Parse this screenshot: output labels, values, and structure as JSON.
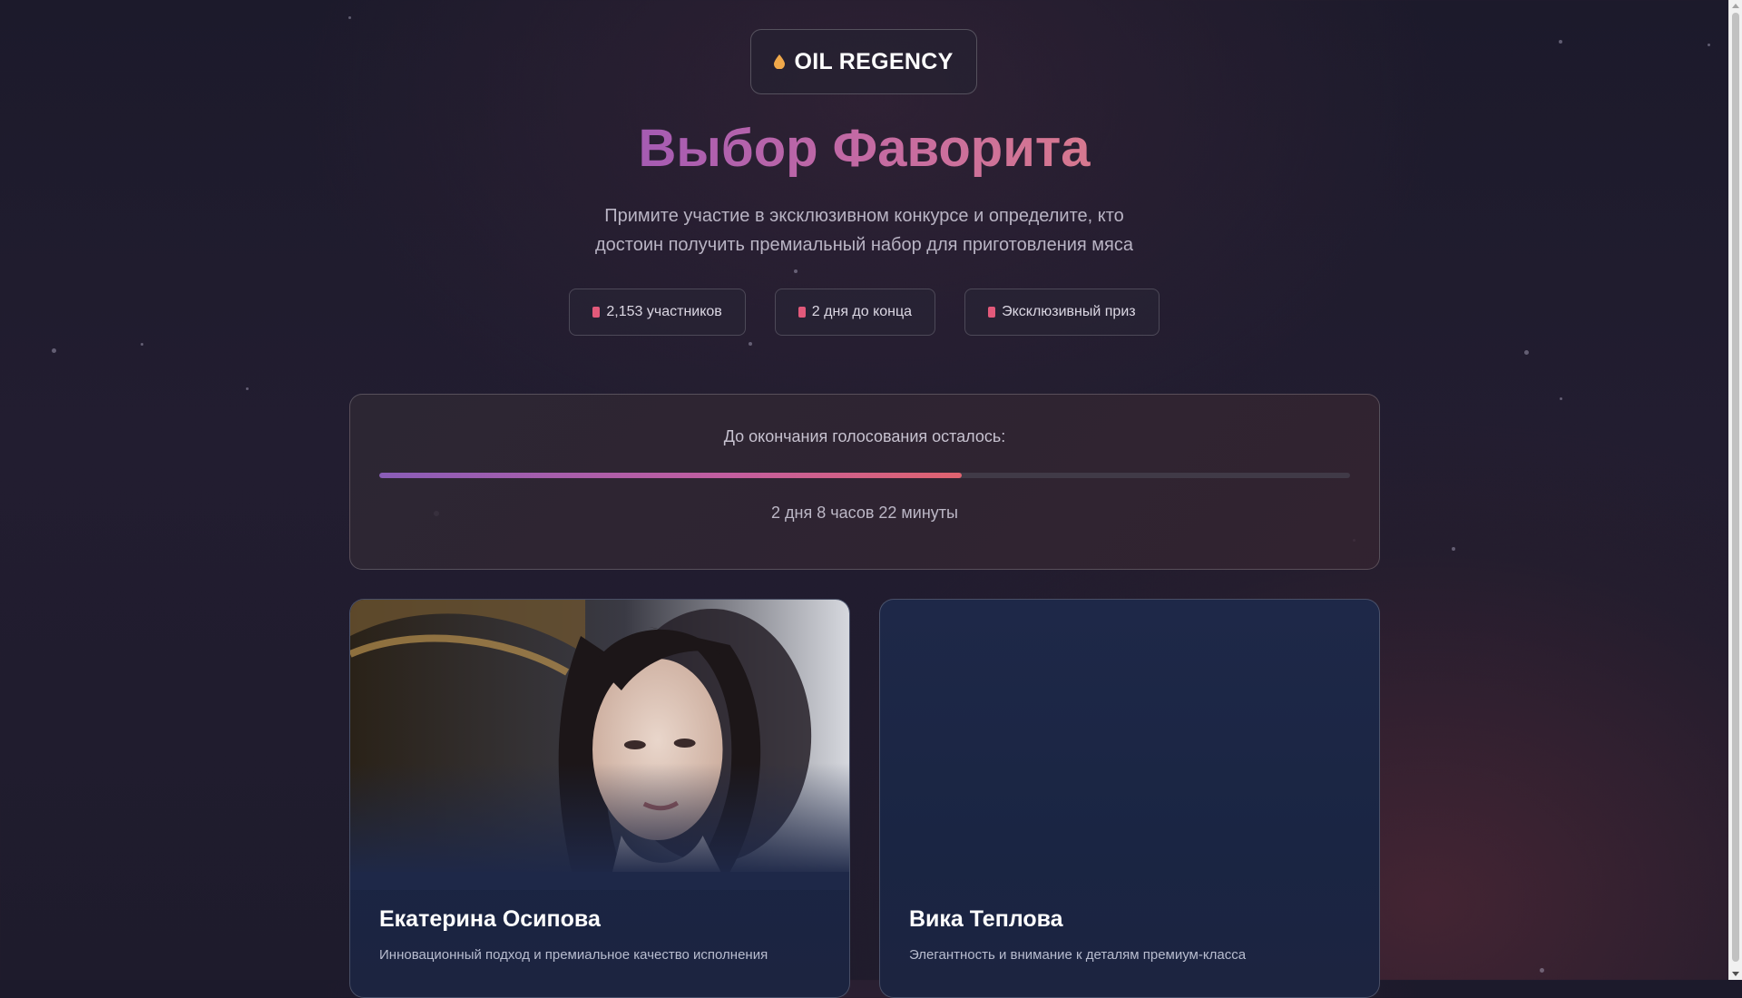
{
  "brand": {
    "name": "OIL REGENCY",
    "icon": "oil-drop-icon"
  },
  "headline": "Выбор Фаворита",
  "subtitle": "Примите участие в эксклюзивном конкурсе и определите, кто достоин получить премиальный набор для приготовления мяса",
  "stats": [
    {
      "label": "2,153 участников",
      "icon": "users-icon"
    },
    {
      "label": "2 дня до конца",
      "icon": "clock-icon"
    },
    {
      "label": "Эксклюзивный приз",
      "icon": "gift-icon"
    }
  ],
  "timer": {
    "label": "До окончания голосования осталось:",
    "remaining": "2 дня 8 часов 22 минуты",
    "progress_fraction": 0.6
  },
  "contestants": [
    {
      "name": "Екатерина Осипова",
      "description": "Инновационный подход и премиальное качество исполнения",
      "has_photo": true
    },
    {
      "name": "Вика Теплова",
      "description": "Элегантность и внимание к деталям премиум-класса",
      "has_photo": false
    }
  ],
  "colors": {
    "accent_start": "#8a5db8",
    "accent_mid": "#c35ea0",
    "accent_end": "#e0636f",
    "card_bg": "#1e2848"
  }
}
